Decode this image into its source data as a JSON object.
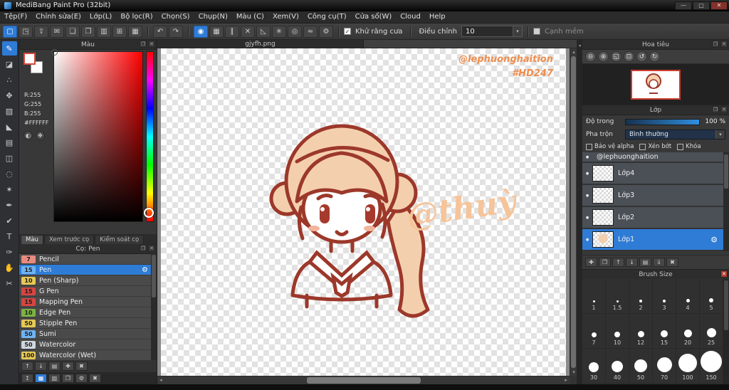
{
  "colors": {
    "accent": "#2f7cd6",
    "watermark": "#ef8e4f",
    "signature": "#f6c49a",
    "outline": "#9c382a",
    "hair": "#f4cfae",
    "eye": "#a63a2c"
  },
  "icons": {
    "detach": "❐",
    "close": "✕",
    "gear": "⚙",
    "dropdown_arrow": "▾",
    "check": "✓",
    "eye_dot": "●",
    "up": "▴",
    "down": "▾",
    "left": "◂",
    "right": "▸"
  },
  "window": {
    "title": "MediBang Paint Pro (32bit)",
    "minimize": "—",
    "maximize": "▢",
    "close": "✕"
  },
  "menu": {
    "items": [
      "Tệp(F)",
      "Chỉnh sửa(E)",
      "Lớp(L)",
      "Bộ lọc(R)",
      "Chọn(S)",
      "Chụp(N)",
      "Màu (C)",
      "Xem(V)",
      "Công cụ(T)",
      "Cửa sổ(W)",
      "Cloud",
      "Help"
    ]
  },
  "toolbar": {
    "file_buttons": [
      {
        "name": "new-canvas",
        "glyph": "▢",
        "selected": true
      },
      {
        "name": "save",
        "glyph": "◳"
      },
      {
        "name": "export",
        "glyph": "⇪"
      },
      {
        "name": "comment",
        "glyph": "✉"
      },
      {
        "name": "gallery",
        "glyph": "❏"
      },
      {
        "name": "copy",
        "glyph": "❐"
      },
      {
        "name": "paste",
        "glyph": "▥"
      },
      {
        "name": "grid-view",
        "glyph": "⊞"
      },
      {
        "name": "material",
        "glyph": "▦"
      }
    ],
    "undo": {
      "glyph": "↶"
    },
    "redo": {
      "glyph": "↷"
    },
    "snap_buttons": [
      {
        "name": "brush-mode",
        "glyph": "◉",
        "selected": true
      },
      {
        "name": "snap-grid",
        "glyph": "▦"
      },
      {
        "name": "snap-parallel",
        "glyph": "∥"
      },
      {
        "name": "snap-cross",
        "glyph": "✕"
      },
      {
        "name": "snap-vanishing",
        "glyph": "◺"
      },
      {
        "name": "snap-radial",
        "glyph": "✳"
      },
      {
        "name": "snap-circle",
        "glyph": "◎"
      },
      {
        "name": "snap-curve",
        "glyph": "≈"
      },
      {
        "name": "snap-settings",
        "glyph": "⚙"
      }
    ],
    "antialias_label": "Khử răng cưa",
    "adjust_label": "Điều chỉnh",
    "adjust_value": "10",
    "soft_edge_label": "Cạnh mềm"
  },
  "tools": [
    {
      "name": "brush-tool",
      "glyph": "✎",
      "selected": true
    },
    {
      "name": "eraser-tool",
      "glyph": "◪"
    },
    {
      "name": "dot-tool",
      "glyph": "∴"
    },
    {
      "name": "move-tool",
      "glyph": "✥"
    },
    {
      "name": "fill-tool",
      "glyph": "▨"
    },
    {
      "name": "bucket-tool",
      "glyph": "◣"
    },
    {
      "name": "gradient-tool",
      "glyph": "▤"
    },
    {
      "name": "select-tool",
      "glyph": "◫"
    },
    {
      "name": "lasso-tool",
      "glyph": "◌"
    },
    {
      "name": "magic-wand-tool",
      "glyph": "✶"
    },
    {
      "name": "select-pen-tool",
      "glyph": "✒"
    },
    {
      "name": "select-eraser-tool",
      "glyph": "✔"
    },
    {
      "name": "text-tool",
      "glyph": "T"
    },
    {
      "name": "eyedropper-tool",
      "glyph": "✑"
    },
    {
      "name": "hand-tool",
      "glyph": "✋"
    },
    {
      "name": "slice-tool",
      "glyph": "✂"
    }
  ],
  "color_panel": {
    "title": "Màu",
    "r": "R:255",
    "g": "G:255",
    "b": "B:255",
    "hex": "#FFFFFF",
    "buttons": [
      {
        "name": "color-wheel",
        "glyph": "◐"
      },
      {
        "name": "palette",
        "glyph": "❖"
      }
    ],
    "tabs": [
      {
        "label": "Màu",
        "active": true
      },
      {
        "label": "Xem trước cọ"
      },
      {
        "label": "Kiểm soát cọ"
      }
    ]
  },
  "brush_panel": {
    "title": "Cọ: Pen",
    "brushes": [
      {
        "size": "7",
        "name": "Pencil",
        "badge": "#e98a80"
      },
      {
        "size": "15",
        "name": "Pen",
        "badge": "#6fb3f2",
        "selected": true
      },
      {
        "size": "10",
        "name": "Pen (Sharp)",
        "badge": "#e5c954"
      },
      {
        "size": "15",
        "name": "G Pen",
        "badge": "#d64541"
      },
      {
        "size": "15",
        "name": "Mapping Pen",
        "badge": "#d64541"
      },
      {
        "size": "10",
        "name": "Edge Pen",
        "badge": "#7cb342"
      },
      {
        "size": "50",
        "name": "Stipple Pen",
        "badge": "#e5c954"
      },
      {
        "size": "50",
        "name": "Sumi",
        "badge": "#6fb3f2"
      },
      {
        "size": "50",
        "name": "Watercolor",
        "badge": "#cfd8dc"
      },
      {
        "size": "100",
        "name": "Watercolor (Wet)",
        "badge": "#e5c954"
      }
    ],
    "footer_buttons": [
      {
        "name": "brush-up",
        "glyph": "↑"
      },
      {
        "name": "brush-down",
        "glyph": "↓"
      },
      {
        "name": "brush-folder",
        "glyph": "▤"
      },
      {
        "name": "brush-add",
        "glyph": "✚"
      },
      {
        "name": "brush-delete",
        "glyph": "✖"
      }
    ]
  },
  "dock_row": [
    {
      "name": "dock-up",
      "glyph": "↥"
    },
    {
      "name": "dock-brush",
      "glyph": "▦",
      "accent": true
    },
    {
      "name": "dock-grid",
      "glyph": "▥"
    },
    {
      "name": "dock-page",
      "glyph": "❐"
    },
    {
      "name": "dock-settings",
      "glyph": "⚙"
    },
    {
      "name": "dock-trash",
      "glyph": "✖"
    }
  ],
  "canvas": {
    "tab": "gjyfh.png",
    "watermark1": "@lephuonghaition",
    "watermark2": "#HD247",
    "signature": "@thuỳ"
  },
  "navigator": {
    "title": "Hoa tiêu",
    "buttons": [
      {
        "name": "zoom-out",
        "glyph": "⊖"
      },
      {
        "name": "zoom-in",
        "glyph": "⊕"
      },
      {
        "name": "zoom-fit",
        "glyph": "◱"
      },
      {
        "name": "zoom-actual",
        "glyph": "⊡"
      },
      {
        "name": "rotate-left",
        "glyph": "↺"
      },
      {
        "name": "rotate-right",
        "glyph": "↻"
      }
    ]
  },
  "layer_panel": {
    "title": "Lớp",
    "opacity_label": "Độ trong",
    "opacity_value": "100 %",
    "blend_label": "Pha trộn",
    "blend_value": "Bình thường",
    "alpha_label": "Bảo vệ alpha",
    "clip_label": "Xén bớt",
    "lock_label": "Khóa",
    "layers": [
      {
        "name": "@lephuonghaition",
        "partial": true
      },
      {
        "name": "Lớp4"
      },
      {
        "name": "Lớp3"
      },
      {
        "name": "Lớp2"
      },
      {
        "name": "Lớp1",
        "selected": true,
        "thumb": "art"
      }
    ],
    "footer_buttons": [
      {
        "name": "layer-add",
        "glyph": "✚"
      },
      {
        "name": "layer-duplicate",
        "glyph": "❐"
      },
      {
        "name": "layer-up",
        "glyph": "↑"
      },
      {
        "name": "layer-down",
        "glyph": "↓"
      },
      {
        "name": "layer-folder",
        "glyph": "▤"
      },
      {
        "name": "layer-merge",
        "glyph": "⇓"
      },
      {
        "name": "layer-delete",
        "glyph": "✖"
      }
    ]
  },
  "brush_size_panel": {
    "title": "Brush Size",
    "sizes": [
      "1",
      "1.5",
      "2",
      "3",
      "4",
      "5",
      "7",
      "10",
      "12",
      "15",
      "20",
      "25",
      "30",
      "40",
      "50",
      "70",
      "100",
      "150"
    ]
  }
}
